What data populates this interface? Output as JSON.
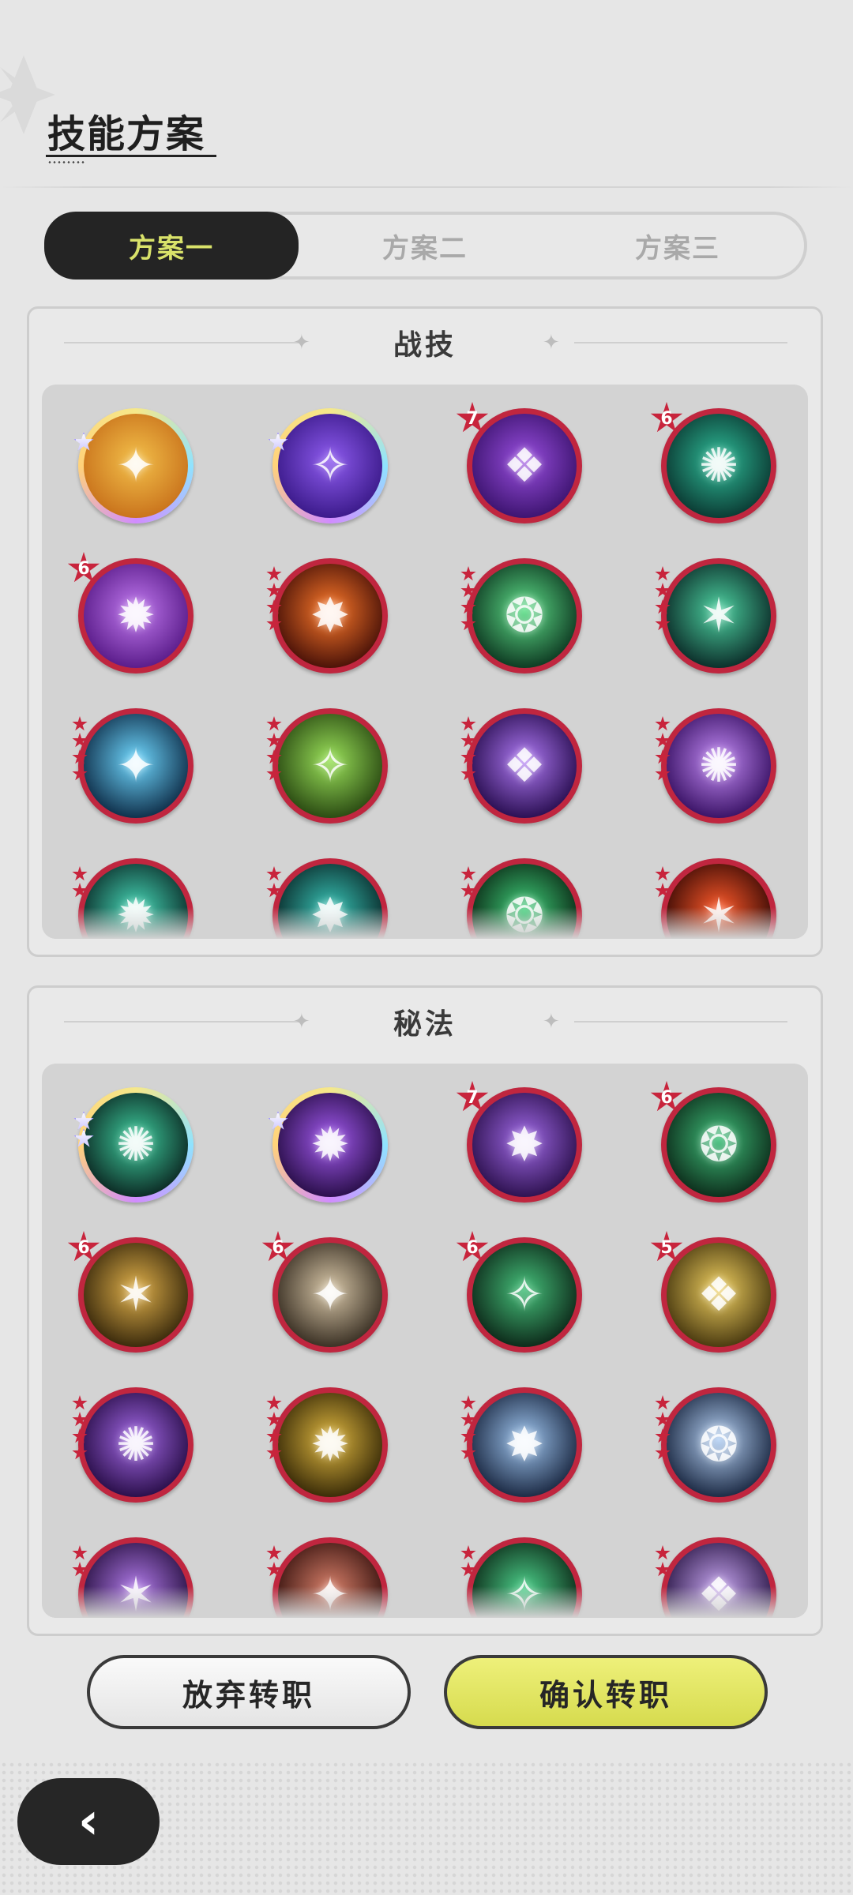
{
  "page": {
    "title": "技能方案"
  },
  "tabs": [
    {
      "label": "方案一",
      "active": true
    },
    {
      "label": "方案二",
      "active": false
    },
    {
      "label": "方案三",
      "active": false
    }
  ],
  "sections": [
    {
      "title": "战技",
      "skills": [
        {
          "icon": "golden-totem-icon",
          "frame": "gold",
          "colors": [
            "#f3c04a",
            "#c9731c"
          ]
        },
        {
          "icon": "purple-vortex-icon",
          "frame": "gold",
          "colors": [
            "#8f5cf0",
            "#3b1a8a"
          ]
        },
        {
          "icon": "purple-shield-icon",
          "frame": "red",
          "rank": "7",
          "colors": [
            "#9a4fe0",
            "#3d1470"
          ]
        },
        {
          "icon": "green-spirit-icon",
          "frame": "red",
          "rank": "6",
          "colors": [
            "#2fbf9a",
            "#0b3a33"
          ]
        },
        {
          "icon": "purple-rune-icon",
          "frame": "red",
          "rank": "6",
          "colors": [
            "#c27af0",
            "#5a1c8a"
          ]
        },
        {
          "icon": "fire-swirl-icon",
          "frame": "red",
          "stars": 4,
          "colors": [
            "#ff7a2a",
            "#4a1208"
          ]
        },
        {
          "icon": "green-comet-icon",
          "frame": "red",
          "stars": 4,
          "colors": [
            "#5fe08a",
            "#0e3a22"
          ]
        },
        {
          "icon": "thorn-vine-icon",
          "frame": "red",
          "stars": 4,
          "colors": [
            "#4cd1a0",
            "#0c2e2a"
          ]
        },
        {
          "icon": "ice-crystal-icon",
          "frame": "red",
          "stars": 4,
          "colors": [
            "#6fd8ff",
            "#0f2f4a"
          ]
        },
        {
          "icon": "tree-stump-icon",
          "frame": "red",
          "stars": 4,
          "colors": [
            "#9be25a",
            "#2a4a12"
          ]
        },
        {
          "icon": "star-burst-icon",
          "frame": "red",
          "stars": 4,
          "colors": [
            "#b07af5",
            "#2a0f52"
          ]
        },
        {
          "icon": "purple-golem-icon",
          "frame": "red",
          "stars": 4,
          "colors": [
            "#c58cf7",
            "#3a1366"
          ]
        },
        {
          "icon": "teal-wave-icon",
          "frame": "red",
          "stars": 2,
          "colors": [
            "#47d9b8",
            "#0b2f2b"
          ]
        },
        {
          "icon": "teal-whirl-icon",
          "frame": "red",
          "stars": 2,
          "colors": [
            "#39c6b8",
            "#0a2b2b"
          ]
        },
        {
          "icon": "green-heal-icon",
          "frame": "red",
          "stars": 2,
          "colors": [
            "#3fd07a",
            "#0b2a16"
          ]
        },
        {
          "icon": "red-flame-icon",
          "frame": "red",
          "stars": 2,
          "colors": [
            "#ff5a2a",
            "#3a0a05"
          ]
        }
      ]
    },
    {
      "title": "秘法",
      "skills": [
        {
          "icon": "green-figure-icon",
          "frame": "gold",
          "gstars": 2,
          "colors": [
            "#3fd0a0",
            "#0c2a24"
          ]
        },
        {
          "icon": "purple-orb-icon",
          "frame": "gold",
          "colors": [
            "#a35af0",
            "#2a0f4a"
          ]
        },
        {
          "icon": "purple-bird-icon",
          "frame": "red",
          "rank": "7",
          "colors": [
            "#a16ae8",
            "#2e1250"
          ]
        },
        {
          "icon": "green-wings-icon",
          "frame": "red",
          "rank": "6",
          "colors": [
            "#3fc07a",
            "#0d2e1c"
          ]
        },
        {
          "icon": "gold-figure-icon",
          "frame": "red",
          "rank": "6",
          "colors": [
            "#e0b04a",
            "#3a2a0c"
          ]
        },
        {
          "icon": "silver-figure-icon",
          "frame": "red",
          "rank": "6",
          "colors": [
            "#d8c7a8",
            "#3a3024"
          ]
        },
        {
          "icon": "green-glyph-icon",
          "frame": "red",
          "rank": "6",
          "colors": [
            "#45c07a",
            "#0d2a1a"
          ]
        },
        {
          "icon": "gold-upgrade-icon",
          "frame": "red",
          "rank": "5",
          "colors": [
            "#f0d060",
            "#4a3a10"
          ]
        },
        {
          "icon": "purple-heart-icon",
          "frame": "red",
          "stars": 4,
          "colors": [
            "#a56ae8",
            "#2a0f4a"
          ]
        },
        {
          "icon": "gold-dash-icon",
          "frame": "red",
          "stars": 4,
          "colors": [
            "#e0b840",
            "#3a2c08"
          ]
        },
        {
          "icon": "blue-gem-icon",
          "frame": "red",
          "stars": 4,
          "colors": [
            "#9fc6f0",
            "#1c2a44"
          ]
        },
        {
          "icon": "blue-sparkle-icon",
          "frame": "red",
          "stars": 4,
          "colors": [
            "#b6d2f5",
            "#1c2a44"
          ]
        },
        {
          "icon": "violet-mist-icon",
          "frame": "red",
          "stars": 2,
          "colors": [
            "#b07ae8",
            "#2a1244"
          ]
        },
        {
          "icon": "red-ember-icon",
          "frame": "red",
          "stars": 2,
          "colors": [
            "#d8806a",
            "#3a1410"
          ]
        },
        {
          "icon": "green-heart-icon",
          "frame": "red",
          "stars": 2,
          "colors": [
            "#4cd08a",
            "#0c2a18"
          ]
        },
        {
          "icon": "lilac-crown-icon",
          "frame": "red",
          "stars": 2,
          "colors": [
            "#c7a6f0",
            "#2e1a4a"
          ]
        }
      ]
    }
  ],
  "buttons": {
    "cancel_label": "放弃转职",
    "confirm_label": "确认转职"
  },
  "back": {
    "icon": "back-chevron-icon"
  },
  "colors": {
    "accent": "#d9e26a",
    "frame_red": "#c0263f",
    "tab_active_bg": "#242424"
  }
}
